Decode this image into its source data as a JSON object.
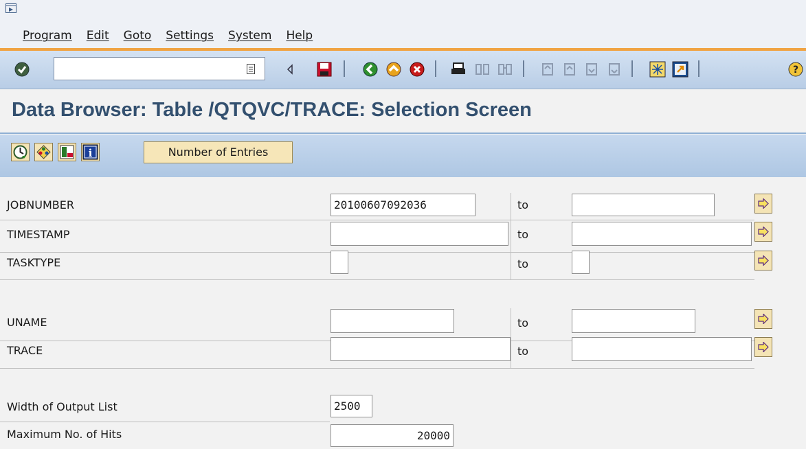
{
  "menu": {
    "items": [
      {
        "label": "Program"
      },
      {
        "label": "Edit"
      },
      {
        "label": "Goto"
      },
      {
        "label": "Settings"
      },
      {
        "label": "System"
      },
      {
        "label": "Help"
      }
    ]
  },
  "toolbar": {
    "command_field_value": "",
    "icons": [
      "enter-check-icon",
      "command-dropdown-icon",
      "collapse-arrow-icon",
      "save-icon",
      "back-icon",
      "exit-icon",
      "cancel-icon",
      "print-icon",
      "find-icon",
      "find-next-icon",
      "first-page-icon",
      "previous-page-icon",
      "next-page-icon",
      "last-page-icon",
      "create-session-icon",
      "shortcut-icon",
      "help-icon"
    ]
  },
  "title": "Data Browser: Table /QTQVC/TRACE: Selection Screen",
  "app_toolbar": {
    "number_of_entries_label": "Number of Entries",
    "icons": [
      "execute-clock-icon",
      "selection-options-icon",
      "layout-icon",
      "info-icon"
    ]
  },
  "form": {
    "to_label": "to",
    "rows": [
      {
        "label": "JOBNUMBER",
        "from": "20100607092036",
        "to": ""
      },
      {
        "label": "TIMESTAMP",
        "from": "",
        "to": ""
      },
      {
        "label": "TASKTYPE",
        "from": "",
        "to": ""
      },
      {
        "label": "UNAME",
        "from": "",
        "to": ""
      },
      {
        "label": "TRACE",
        "from": "",
        "to": ""
      }
    ],
    "width_label": "Width of Output List",
    "width_value": "2500",
    "max_hits_label": "Maximum No. of Hits",
    "max_hits_value": "20000"
  },
  "colors": {
    "title": "#33506f",
    "menu_accent": "#f0a342",
    "toolbar": "#c6d8ee",
    "button_fill": "#f4e4b5"
  }
}
